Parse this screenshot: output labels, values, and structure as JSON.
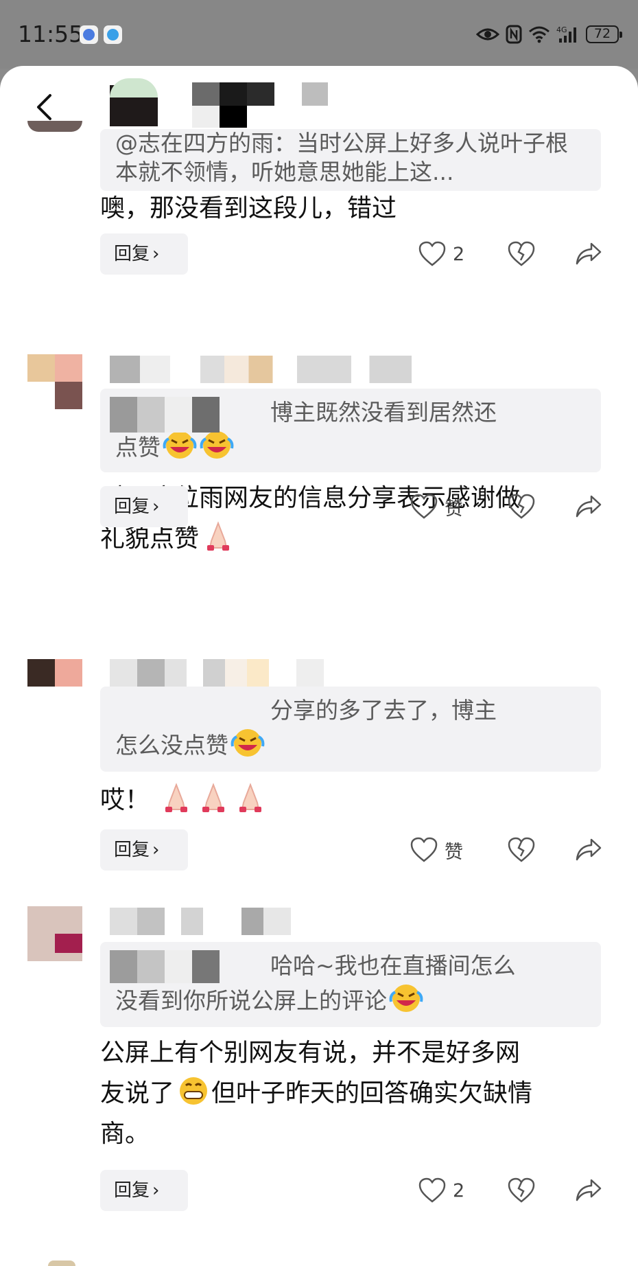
{
  "status_bar": {
    "time": "11:55",
    "battery": "72"
  },
  "comments": [
    {
      "quote": "@志在四方的雨：当时公屏上好多人说叶子根本就不领情，听她意思她能上这...",
      "text": "噢，那没看到这段儿，错过",
      "reply_label": "回复",
      "likes": "2"
    },
    {
      "quote_line1": "博主既然没看到居然还",
      "quote_line2": "点赞",
      "text_line1": "对于这位雨网友的信息分享表示感谢做",
      "text_line2": "礼貌点赞",
      "reply_label": "回复",
      "likes": "赞"
    },
    {
      "quote_line1": "分享的多了去了，博主",
      "quote_line2": "怎么没点赞",
      "text": "哎！",
      "reply_label": "回复",
      "likes": "赞"
    },
    {
      "quote_line1": "哈哈~我也在直播间怎么",
      "quote_line2": "没看到你所说公屏上的评论",
      "text_line1": "公屏上有个别网友有说，并不是好多网",
      "text_line2a": "友说了",
      "text_line2b": "但叶子昨天的回答确实欠缺情",
      "text_line3": "商。",
      "reply_label": "回复",
      "likes": "2"
    }
  ],
  "icons": {
    "back": "chevron-left-icon",
    "like": "heart-icon",
    "dislike": "broken-heart-icon",
    "share": "share-arrow-icon",
    "laugh": "rolling-laughing-emoji",
    "pray": "folded-hands-emoji",
    "grin": "grinning-emoji"
  },
  "colors": {
    "quote_bg": "#f2f2f4",
    "status_bg": "#878787",
    "text": "#111111",
    "muted": "#5b5b5b"
  }
}
